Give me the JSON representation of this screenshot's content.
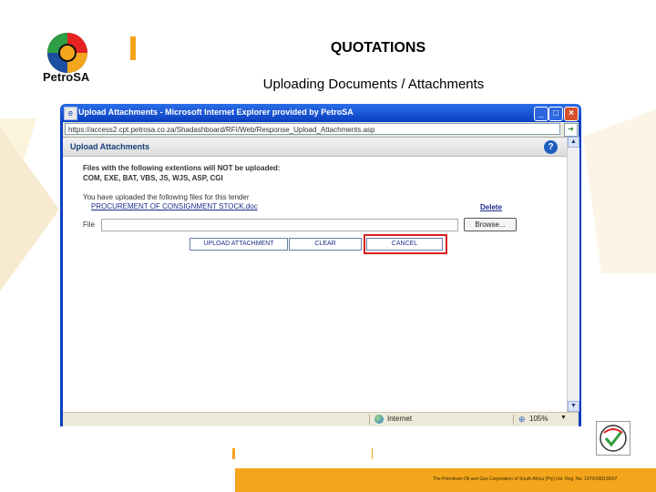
{
  "slide": {
    "logo_text": "PetroSA",
    "title": "QUOTATIONS",
    "subtitle": "Uploading Documents / Attachments",
    "footer_text": "The Petroleum Oil and Gas Corporation of South Africa (Pty) Ltd. Reg. No. 1970/008130/07"
  },
  "browser": {
    "window_title": "Upload Attachments - Microsoft Internet Explorer provided by PetroSA",
    "address": "https://access2.cpt.petrosa.co.za/Shadashboard/RFI/Web/Response_Upload_Attachments.asp",
    "status_zone": "Internet",
    "zoom": "105%"
  },
  "dialog": {
    "title": "Upload Attachments",
    "warning_heading": "Files with the following extentions will NOT be uploaded:",
    "warning_list": "COM, EXE, BAT, VBS, JS, WJS, ASP, CGI",
    "uploaded_intro": "You have uploaded the following files for this tender",
    "uploaded_file": "PROCUREMENT OF CONSIGNMENT STOCK.doc",
    "delete_label": "Delete",
    "file_label": "File",
    "browse_label": "Browse...",
    "upload_label": "UPLOAD ATTACHMENT",
    "clear_label": "CLEAR",
    "cancel_label": "CANCEL"
  },
  "colors": {
    "accent": "#f3a51c",
    "titlebar": "#0a3fbf",
    "highlight": "#d81f1f"
  },
  "icons": [
    "petrosa-logo-icon",
    "page-icon",
    "minimize-icon",
    "maximize-icon",
    "close-icon",
    "go-icon",
    "help-icon",
    "scroll-up-icon",
    "scroll-down-icon",
    "globe-icon",
    "zoom-icon",
    "certification-badge-icon"
  ]
}
